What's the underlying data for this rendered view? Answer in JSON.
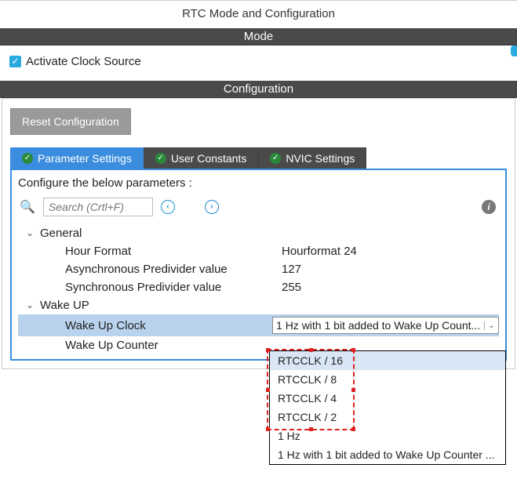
{
  "title": "RTC Mode and Configuration",
  "banners": {
    "mode": "Mode",
    "configuration": "Configuration"
  },
  "mode": {
    "activate_label": "Activate Clock Source",
    "activate_checked": true
  },
  "reset_button": "Reset Configuration",
  "tabs": [
    {
      "label": "Parameter Settings",
      "active": true
    },
    {
      "label": "User Constants",
      "active": false
    },
    {
      "label": "NVIC Settings",
      "active": false
    }
  ],
  "panel_title": "Configure the below parameters :",
  "search": {
    "placeholder": "Search (Crtl+F)"
  },
  "groups": {
    "general": {
      "name": "General",
      "hour_format": {
        "label": "Hour Format",
        "value": "Hourformat 24"
      },
      "async_prediv": {
        "label": "Asynchronous Predivider value",
        "value": "127"
      },
      "sync_prediv": {
        "label": "Synchronous Predivider value",
        "value": "255"
      }
    },
    "wakeup": {
      "name": "Wake UP",
      "clock": {
        "label": "Wake Up Clock",
        "value": "1 Hz with 1 bit added to Wake Up Count..."
      },
      "counter": {
        "label": "Wake Up Counter"
      }
    }
  },
  "dropdown_options": [
    "RTCCLK / 16",
    "RTCCLK / 8",
    "RTCCLK / 4",
    "RTCCLK / 2",
    "1 Hz",
    "1 Hz with 1 bit added to Wake Up Counter ..."
  ]
}
